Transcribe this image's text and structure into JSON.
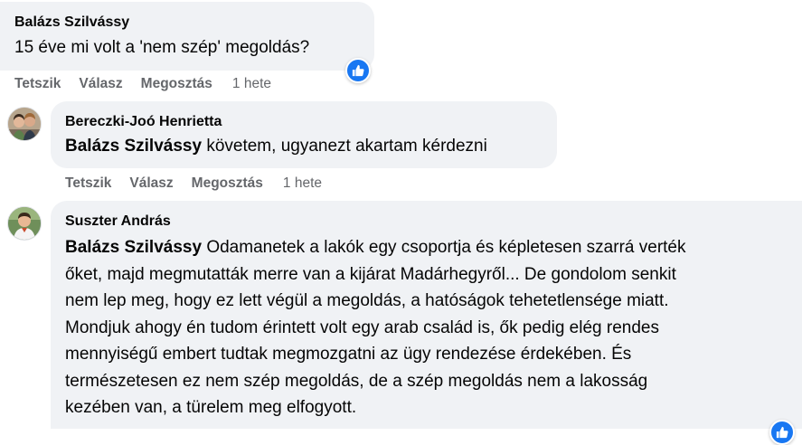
{
  "comments": [
    {
      "author": "Balázs Szilvássy",
      "text": "15 éve mi volt a 'nem szép' megoldás?",
      "actions": {
        "like": "Tetszik",
        "reply": "Válasz",
        "share": "Megosztás",
        "time": "1 hete"
      }
    },
    {
      "author": "Bereczki-Joó Henrietta",
      "mention": "Balázs Szilvássy",
      "text": "követem, ugyanezt akartam kérdezni",
      "actions": {
        "like": "Tetszik",
        "reply": "Válasz",
        "share": "Megosztás",
        "time": "1 hete"
      }
    },
    {
      "author": "Suszter András",
      "mention": "Balázs Szilvássy",
      "lines": [
        "Odamanetek a lakók egy csoportja és képletesen szarrá verték",
        "őket, majd megmutatták merre van a kijárat Madárhegyről... De gondolom senkit",
        "nem lep meg, hogy ez lett végül a megoldás, a hatóságok tehetetlensége miatt.",
        "Mondjuk ahogy én tudom érintett volt egy arab család is, ők pedig elég rendes",
        "mennyiségű embert tudtak megmozgatni az ügy rendezése érdekében. És",
        "természetesen ez nem szép megoldás, de a szép megoldás nem a lakosság",
        "kezében van, a türelem meg elfogyott."
      ]
    }
  ],
  "colors": {
    "bubble": "#f0f2f5",
    "meta": "#65676b",
    "like": "#1877f2"
  },
  "icons": [
    "like-thumb-icon"
  ]
}
